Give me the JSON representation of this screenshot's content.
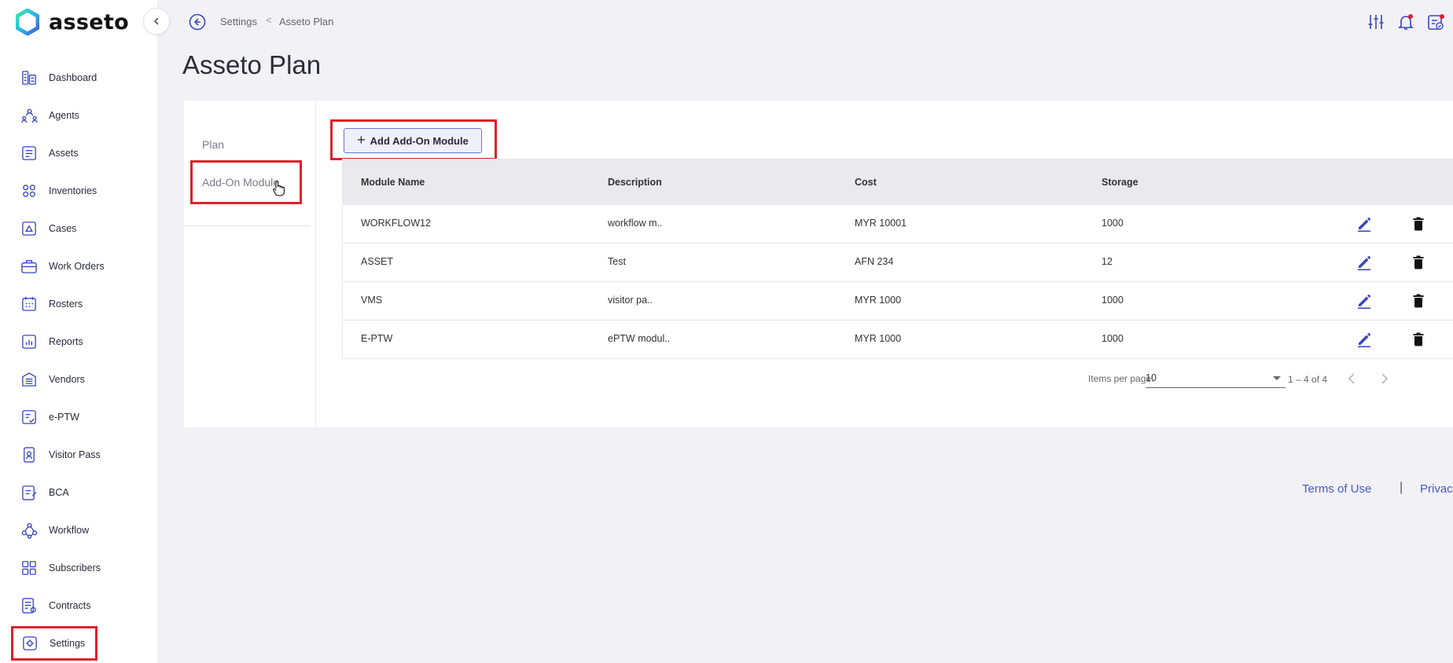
{
  "brand": {
    "name": "asseto"
  },
  "sidebar": {
    "items": [
      {
        "label": "Dashboard",
        "icon": "dashboard-icon"
      },
      {
        "label": "Agents",
        "icon": "agents-icon"
      },
      {
        "label": "Assets",
        "icon": "assets-icon"
      },
      {
        "label": "Inventories",
        "icon": "inventories-icon"
      },
      {
        "label": "Cases",
        "icon": "cases-icon"
      },
      {
        "label": "Work Orders",
        "icon": "work-orders-icon"
      },
      {
        "label": "Rosters",
        "icon": "rosters-icon"
      },
      {
        "label": "Reports",
        "icon": "reports-icon"
      },
      {
        "label": "Vendors",
        "icon": "vendors-icon"
      },
      {
        "label": "e-PTW",
        "icon": "eptw-icon"
      },
      {
        "label": "Visitor Pass",
        "icon": "visitor-pass-icon"
      },
      {
        "label": "BCA",
        "icon": "bca-icon"
      },
      {
        "label": "Workflow",
        "icon": "workflow-icon"
      },
      {
        "label": "Subscribers",
        "icon": "subscribers-icon"
      },
      {
        "label": "Contracts",
        "icon": "contracts-icon"
      },
      {
        "label": "Settings",
        "icon": "settings-icon",
        "active": true
      }
    ]
  },
  "breadcrumb": {
    "parent": "Settings",
    "separator": "<",
    "current": "Asseto Plan"
  },
  "page": {
    "title": "Asseto Plan"
  },
  "tabs": {
    "plan": "Plan",
    "addon": "Add-On Module"
  },
  "toolbar": {
    "add_label": "Add Add-On Module"
  },
  "table": {
    "headers": [
      "Module Name",
      "Description",
      "Cost",
      "Storage"
    ],
    "rows": [
      {
        "name": "WORKFLOW12",
        "description": "workflow m..",
        "cost": "MYR 10001",
        "storage": "1000"
      },
      {
        "name": "ASSET",
        "description": "Test",
        "cost": "AFN 234",
        "storage": "12"
      },
      {
        "name": "VMS",
        "description": "visitor pa..",
        "cost": "MYR 1000",
        "storage": "1000"
      },
      {
        "name": "E-PTW",
        "description": "ePTW modul..",
        "cost": "MYR 1000",
        "storage": "1000"
      }
    ]
  },
  "pagination": {
    "items_label": "Items per page:",
    "per_page": "10",
    "range": "1 – 4 of 4"
  },
  "footer": {
    "terms": "Terms of Use",
    "separator": "|",
    "privacy": "Privac"
  },
  "colors": {
    "accent": "#4a58c8",
    "highlight": "#e0202a",
    "icon": "#3a46c0"
  }
}
